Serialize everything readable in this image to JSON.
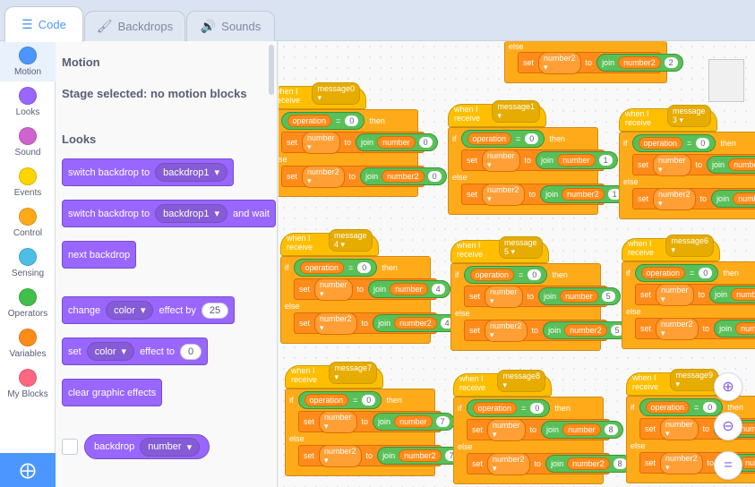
{
  "tabs": [
    {
      "label": "Code",
      "icon": "code-icon"
    },
    {
      "label": "Backdrops",
      "icon": "brush-icon"
    },
    {
      "label": "Sounds",
      "icon": "speaker-icon"
    }
  ],
  "categories": [
    {
      "label": "Motion",
      "color": "#4c97ff"
    },
    {
      "label": "Looks",
      "color": "#9966ff"
    },
    {
      "label": "Sound",
      "color": "#cf63cf"
    },
    {
      "label": "Events",
      "color": "#ffd500"
    },
    {
      "label": "Control",
      "color": "#ffab19"
    },
    {
      "label": "Sensing",
      "color": "#4cbfe6"
    },
    {
      "label": "Operators",
      "color": "#40bf4a"
    },
    {
      "label": "Variables",
      "color": "#ff8c1a"
    },
    {
      "label": "My Blocks",
      "color": "#ff6680"
    }
  ],
  "palette": {
    "motion_title": "Motion",
    "motion_note": "Stage selected: no motion blocks",
    "looks_title": "Looks",
    "switch_backdrop": {
      "prefix": "switch backdrop to",
      "value": "backdrop1"
    },
    "switch_backdrop_wait": {
      "prefix": "switch backdrop to",
      "value": "backdrop1",
      "suffix": "and wait"
    },
    "next_backdrop": "next backdrop",
    "change_effect": {
      "prefix": "change",
      "effect": "color",
      "middle": "effect by",
      "value": "25"
    },
    "set_effect": {
      "prefix": "set",
      "effect": "color",
      "middle": "effect to",
      "value": "0"
    },
    "clear_effects": "clear graphic effects",
    "backdrop_reporter": {
      "label": "backdrop",
      "value": "number"
    }
  },
  "blocks": {
    "when_receive": "when I receive",
    "if": "if",
    "then": "then",
    "else": "else",
    "set": "set",
    "to": "to",
    "join": "join",
    "operation": "operation",
    "eq": "=",
    "zero": "0",
    "number": "number",
    "number2": "number2"
  },
  "scripts": [
    {
      "message": "message0",
      "value": "0"
    },
    {
      "message": "message1",
      "value": "1"
    },
    {
      "message": "message 3",
      "value": "3"
    },
    {
      "message": "message 4",
      "value": "4"
    },
    {
      "message": "message 5",
      "value": "5"
    },
    {
      "message": "message6",
      "value": "6"
    },
    {
      "message": "message7",
      "value": "7"
    },
    {
      "message": "message8",
      "value": "8"
    },
    {
      "message": "message9",
      "value": "9"
    }
  ],
  "top_partial": {
    "value": "2"
  },
  "zoom": {
    "in": "zoom-in-icon",
    "out": "zoom-out-icon",
    "reset": "zoom-reset-icon"
  }
}
